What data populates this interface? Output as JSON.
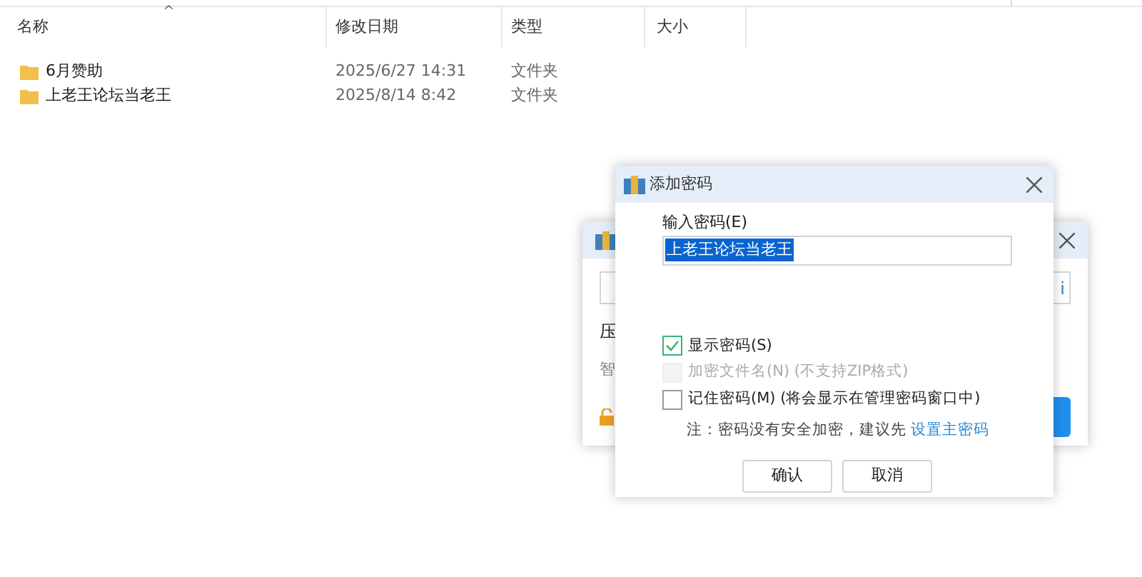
{
  "file_list": {
    "sort_indicator": "^",
    "columns": [
      "名称",
      "修改日期",
      "类型",
      "大小"
    ],
    "rows": [
      {
        "name": "6月赞助",
        "modified": "2025/6/27 14:31",
        "type": "文件夹"
      },
      {
        "name": "上老王论坛当老王",
        "modified": "2025/8/14 8:42",
        "type": "文件夹"
      }
    ]
  },
  "back_dialog": {
    "field_right_text": "i",
    "label_1": "压",
    "label_2": "智"
  },
  "password_dialog": {
    "title": "添加密码",
    "field_label": "输入密码(E)",
    "password": "上老王论坛当老王",
    "options": [
      {
        "label": "显示密码(S)",
        "checked": true,
        "disabled": false
      },
      {
        "label": "加密文件名(N) (不支持ZIP格式)",
        "checked": false,
        "disabled": true
      },
      {
        "label": "记住密码(M) (将会显示在管理密码窗口中)",
        "checked": false,
        "disabled": false
      }
    ],
    "note": "注：密码没有安全加密，建议先",
    "note_link": "设置主密码",
    "buttons": [
      "确认",
      "取消"
    ]
  }
}
